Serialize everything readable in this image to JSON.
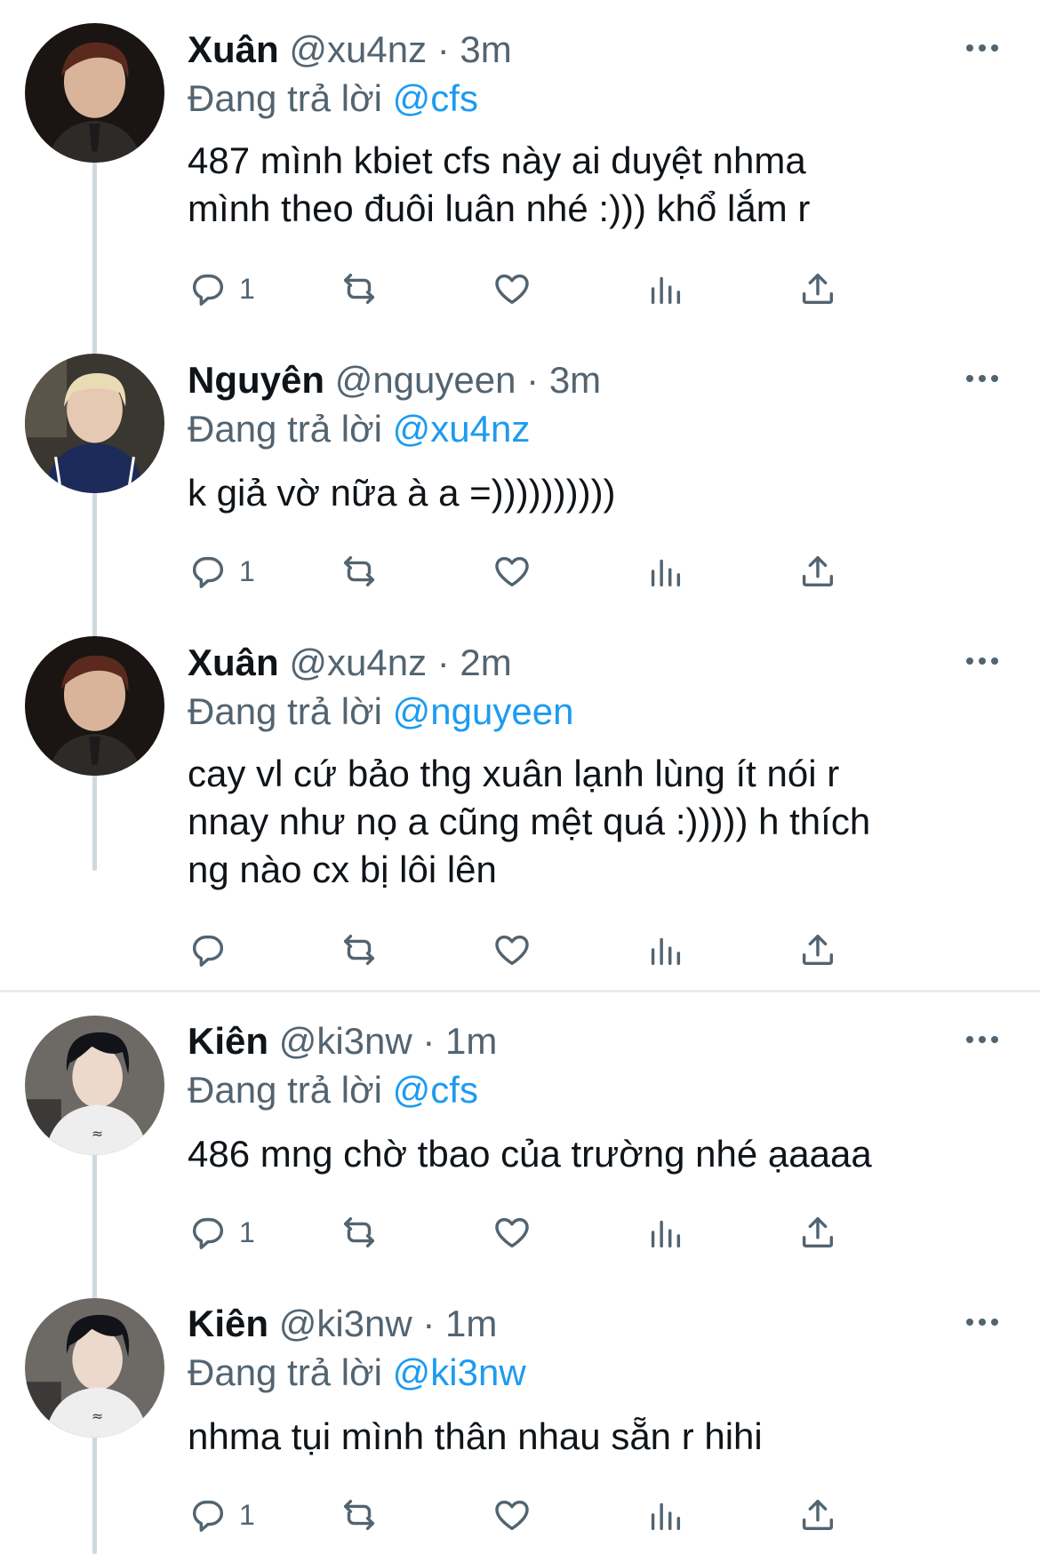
{
  "colors": {
    "link": "#1d9bf0",
    "muted": "#536471",
    "text": "#0f1419",
    "line": "#cfd9de"
  },
  "tweets": [
    {
      "name": "Xuân",
      "handle": "@xu4nz",
      "sep": "·",
      "time": "3m",
      "reply_prefix": "Đang trả lời",
      "reply_to": "@cfs",
      "lines": [
        "487 mình kbiet cfs này ai duyệt nhma",
        "mình theo đuôi luân nhé :))) khổ lắm r"
      ],
      "reply_count": "1"
    },
    {
      "name": "Nguyên",
      "handle": "@nguyeen",
      "sep": "·",
      "time": "3m",
      "reply_prefix": "Đang trả lời",
      "reply_to": "@xu4nz",
      "lines": [
        "k giả vờ nữa à a =))))))))))"
      ],
      "reply_count": "1"
    },
    {
      "name": "Xuân",
      "handle": "@xu4nz",
      "sep": "·",
      "time": "2m",
      "reply_prefix": "Đang trả lời",
      "reply_to": "@nguyeen",
      "lines": [
        "cay vl cứ bảo thg xuân lạnh lùng ít nói r",
        "nnay như nọ a cũng mệt quá :))))) h thích",
        "ng nào cx bị lôi lên"
      ],
      "reply_count": ""
    },
    {
      "name": "Kiên",
      "handle": "@ki3nw",
      "sep": "·",
      "time": "1m",
      "reply_prefix": "Đang trả lời",
      "reply_to": "@cfs",
      "lines": [
        "486 mng chờ tbao của trường nhé ạaaaa"
      ],
      "reply_count": "1"
    },
    {
      "name": "Kiên",
      "handle": "@ki3nw",
      "sep": "·",
      "time": "1m",
      "reply_prefix": "Đang trả lời",
      "reply_to": "@ki3nw",
      "lines": [
        "nhma tụi mình thân nhau sẵn r hihi"
      ],
      "reply_count": "1"
    }
  ],
  "icons": {
    "reply": "reply-icon",
    "retweet": "retweet-icon",
    "like": "heart-icon",
    "views": "views-icon",
    "share": "share-icon",
    "more": "more-icon"
  }
}
